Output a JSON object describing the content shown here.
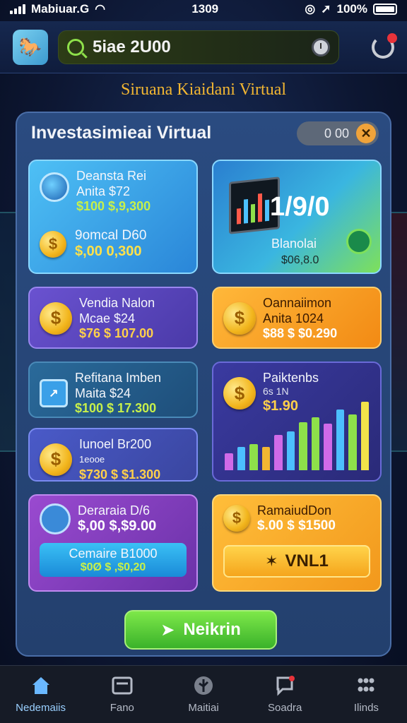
{
  "status": {
    "carrier": "Mabiuar.G",
    "time": "1309",
    "battery": "100%"
  },
  "header": {
    "search_value": "5iae 2U00"
  },
  "page_title": "Siruana Kiaidani Virtual",
  "panel": {
    "title": "Investasimieai Virtual",
    "toggle_value": "0 00",
    "close_label": "✕"
  },
  "cards": {
    "c1": {
      "line1": "Deansta Rei",
      "line2": "Anita $72",
      "value": "$100 $,9,300",
      "line3": "9omcal D60",
      "value2": "$,00 0,300"
    },
    "c2": {
      "big_value": "1/9/0",
      "label": "Blanolai",
      "value": "$06,8.0"
    },
    "c3": {
      "line1": "Vendia Nalon",
      "line2": "Mcae $24",
      "value": "$76 $ 107.00"
    },
    "c4": {
      "line1": "Oannaiimon",
      "line2": "Anita 1024",
      "value": "$88 $ $0.290"
    },
    "c5": {
      "line1": "Refitana Imben",
      "line2": "Maita $24",
      "value": "$100 $ 17.300"
    },
    "c6": {
      "line1": "Iunoel Br200",
      "line2": "1eooe",
      "value": "$730 $ $1.300"
    },
    "c7": {
      "line1": "Paiktenbs",
      "line2": "6s 1N",
      "value": "$1.90"
    },
    "c8": {
      "line1": "Deraraia D/6",
      "value": "$,00 $,$9.00",
      "btn_line1": "Cemaire B1000",
      "btn_line2": "$0Ø $ ,$0,20"
    },
    "c9": {
      "line1": "RamaiudDon",
      "value": "$.00 $ $1500",
      "btn_label": "VNL1"
    }
  },
  "action_button": {
    "label": "Neikrin"
  },
  "nav": [
    {
      "label": "Nedemaiis",
      "icon": "home-icon"
    },
    {
      "label": "Fano",
      "icon": "card-icon"
    },
    {
      "label": "Maitiai",
      "icon": "target-icon"
    },
    {
      "label": "Soadra",
      "icon": "chat-icon"
    },
    {
      "label": "Ilinds",
      "icon": "grid-icon"
    }
  ],
  "chart_bars": [
    {
      "value": 0.22,
      "color": "#d06ae8"
    },
    {
      "value": 0.3,
      "color": "#4cc0ff"
    },
    {
      "value": 0.34,
      "color": "#8ee04a"
    },
    {
      "value": 0.3,
      "color": "#f2b632"
    },
    {
      "value": 0.45,
      "color": "#d06ae8"
    },
    {
      "value": 0.5,
      "color": "#4cc0ff"
    },
    {
      "value": 0.62,
      "color": "#8ee04a"
    },
    {
      "value": 0.68,
      "color": "#8ee04a"
    },
    {
      "value": 0.6,
      "color": "#d06ae8"
    },
    {
      "value": 0.78,
      "color": "#4cc0ff"
    },
    {
      "value": 0.72,
      "color": "#8ee04a"
    },
    {
      "value": 0.88,
      "color": "#f2e24a"
    }
  ]
}
